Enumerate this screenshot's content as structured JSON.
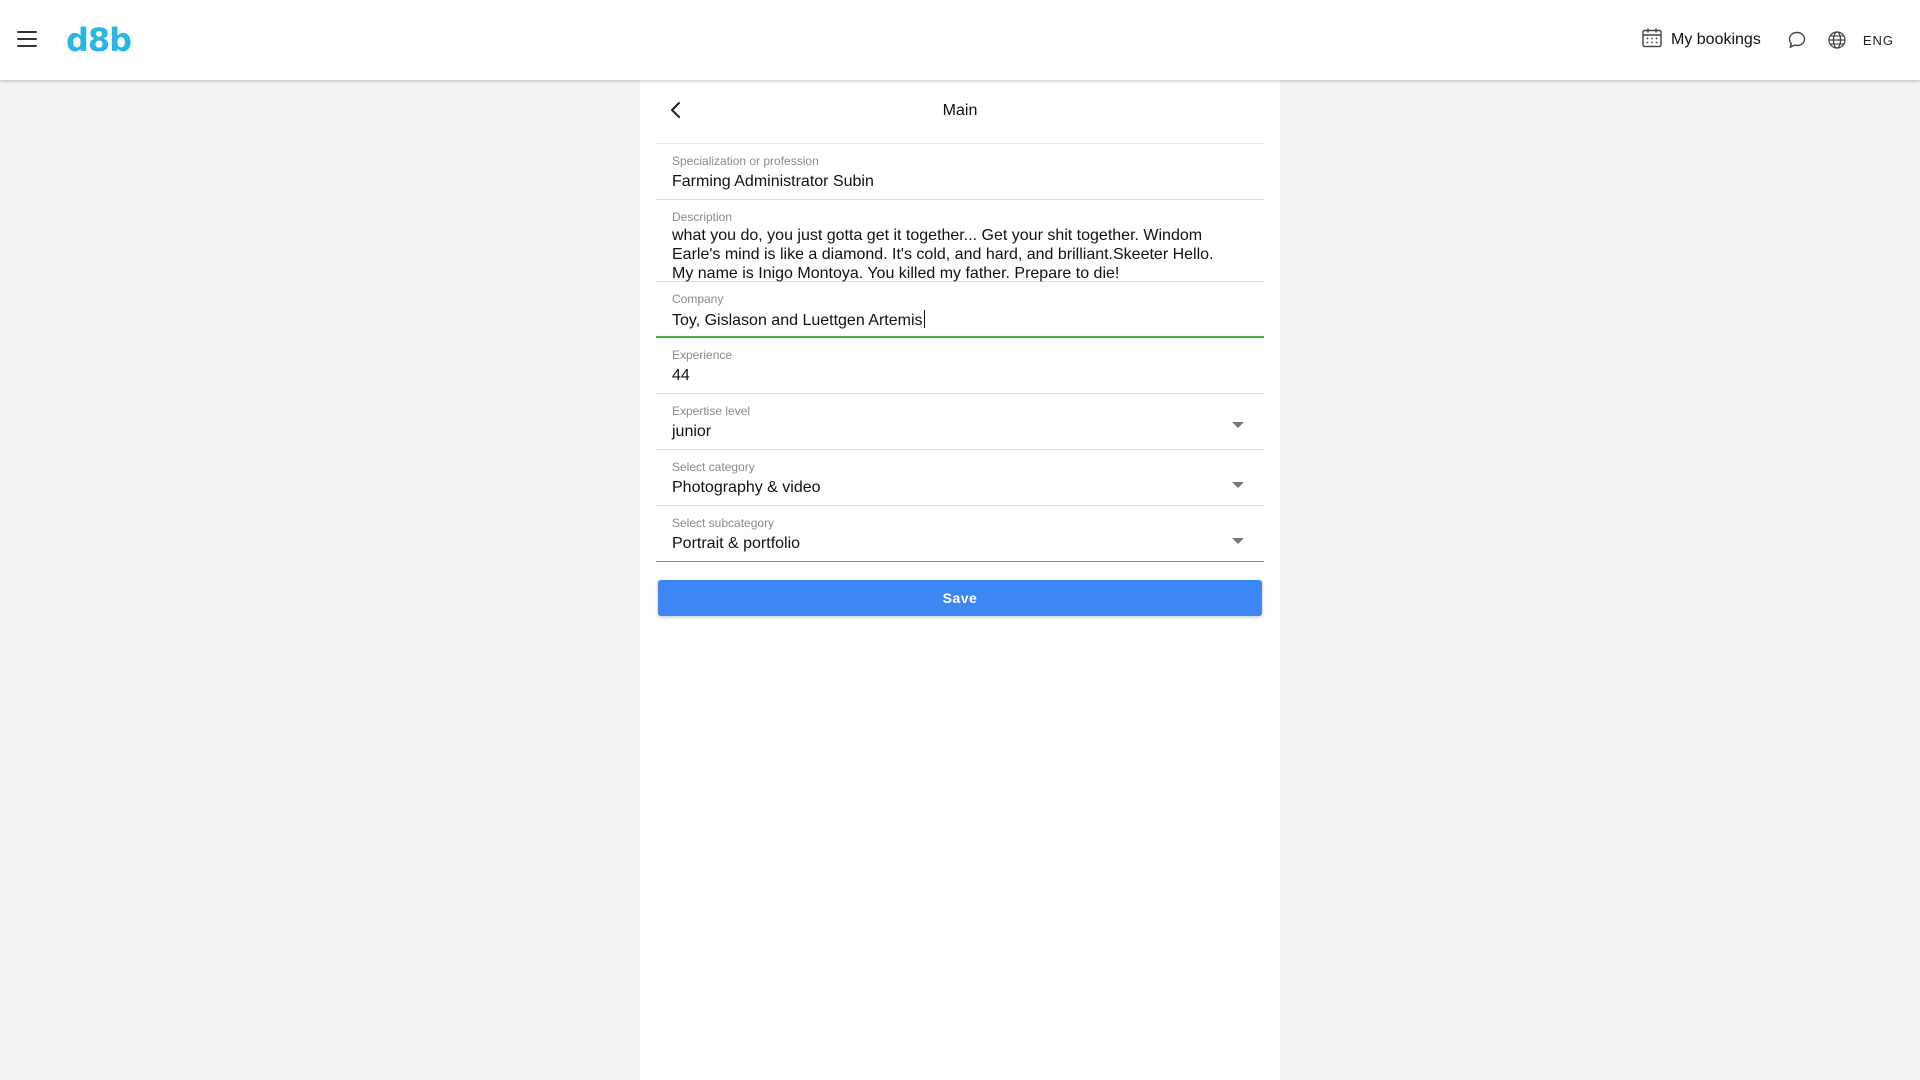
{
  "topbar": {
    "logo": "d8b",
    "bookings_label": "My bookings",
    "language": "ENG"
  },
  "panel": {
    "title": "Main"
  },
  "form": {
    "specialization": {
      "label": "Specialization or profession",
      "value": "Farming Administrator Subin"
    },
    "description": {
      "label": "Description",
      "value": "what you do, you just gotta get it together... Get your shit together. Windom Earle's mind is like a diamond. It's cold, and hard, and brilliant.Skeeter Hello. My name is Inigo Montoya. You killed my father. Prepare to die!"
    },
    "company": {
      "label": "Company",
      "value": "Toy, Gislason and Luettgen Artemis"
    },
    "experience": {
      "label": "Experience",
      "value": "44"
    },
    "expertise": {
      "label": "Expertise level",
      "value": "junior"
    },
    "category": {
      "label": "Select category",
      "value": "Photography & video"
    },
    "subcategory": {
      "label": "Select subcategory",
      "value": "Portrait & portfolio"
    },
    "save_label": "Save"
  },
  "colors": {
    "brand": "#29b6e0",
    "primary_button": "#3d87f5",
    "active_underline": "#4caf50"
  },
  "icons": [
    "menu-icon",
    "calendar-icon",
    "chat-icon",
    "globe-icon",
    "chevron-left-icon",
    "dropdown-arrow-icon"
  ]
}
